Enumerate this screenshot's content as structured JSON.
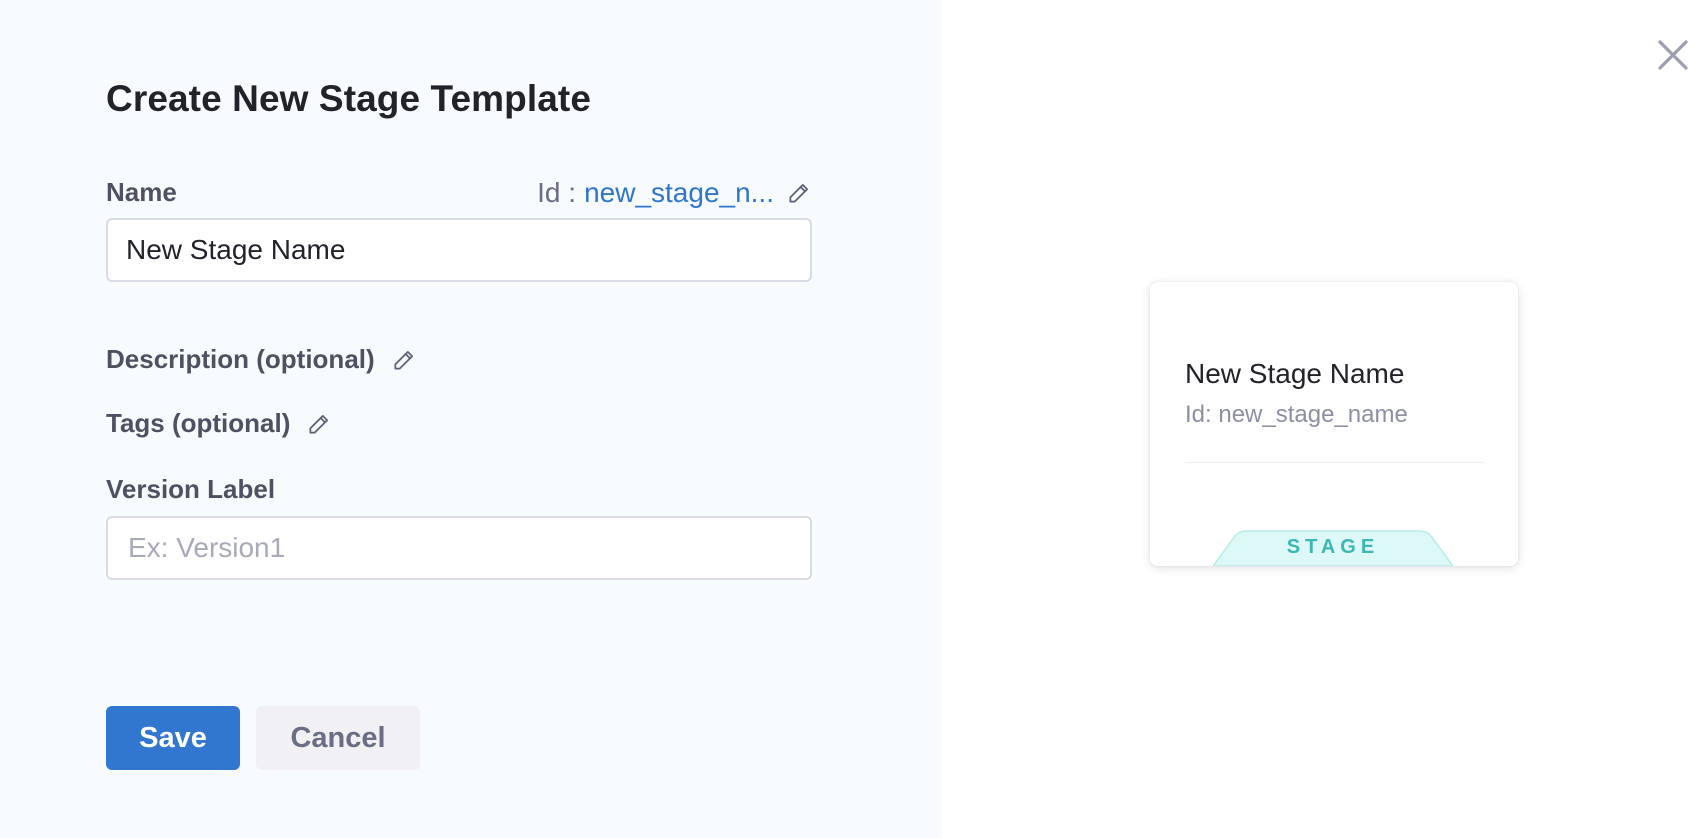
{
  "dialog": {
    "title": "Create New Stage Template"
  },
  "form": {
    "name_label": "Name",
    "id_prefix": "Id :",
    "id_value": "new_stage_n...",
    "name_value": "New Stage Name",
    "description_label": "Description (optional)",
    "tags_label": "Tags (optional)",
    "version_label": "Version Label",
    "version_placeholder": "Ex: Version1",
    "version_value": ""
  },
  "buttons": {
    "save_label": "Save",
    "cancel_label": "Cancel"
  },
  "preview_card": {
    "name": "New Stage Name",
    "id_text": "Id: new_stage_name",
    "type_tag": "STAGE"
  },
  "icons": {
    "edit": "pencil-icon",
    "close": "close-icon"
  },
  "colors": {
    "primary": "#3177d0",
    "link": "#3075c9",
    "left_panel_bg": "#f7fbfe",
    "tag_bg": "#dcf9f8",
    "tag_text": "#3fb7b1"
  }
}
